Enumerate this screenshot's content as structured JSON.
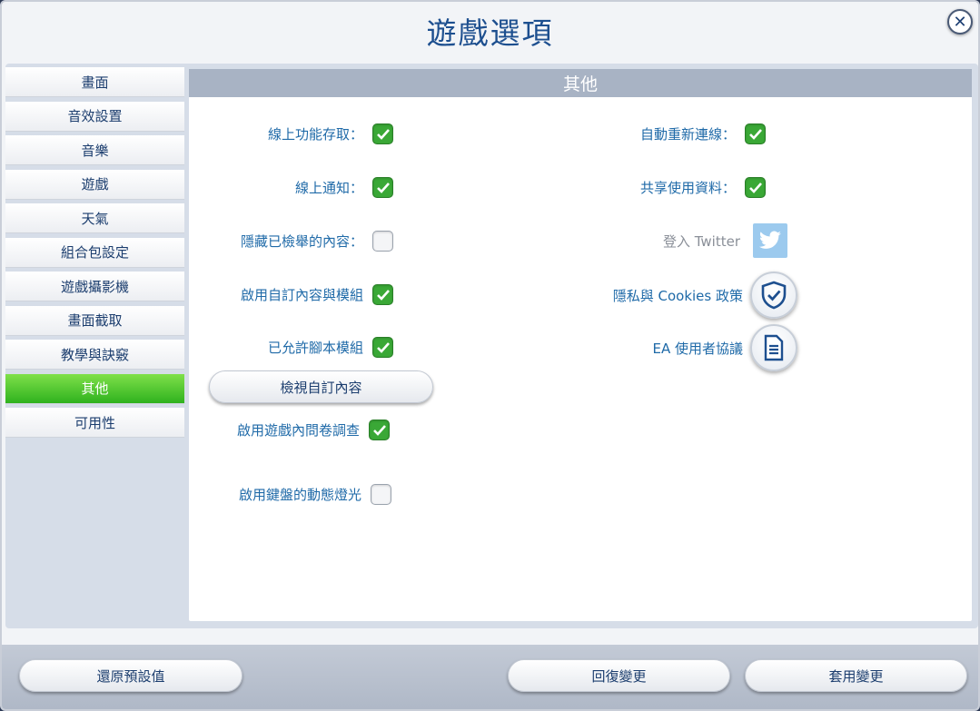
{
  "window": {
    "title": "遊戲選項",
    "close_icon": "close-icon"
  },
  "sidebar": {
    "items": [
      {
        "label": "畫面"
      },
      {
        "label": "音效設置"
      },
      {
        "label": "音樂"
      },
      {
        "label": "遊戲"
      },
      {
        "label": "天氣"
      },
      {
        "label": "組合包設定"
      },
      {
        "label": "遊戲攝影機"
      },
      {
        "label": "畫面截取"
      },
      {
        "label": "教學與訣竅"
      },
      {
        "label": "其他",
        "active": true
      },
      {
        "label": "可用性"
      }
    ],
    "active_color": "#4cc832"
  },
  "section": {
    "title": "其他",
    "left_options": [
      {
        "label": "線上功能存取：",
        "checked": true
      },
      {
        "label": "線上通知：",
        "checked": true
      },
      {
        "label": "隱藏已檢舉的內容：",
        "checked": false
      },
      {
        "label": "啟用自訂內容與模組",
        "checked": true
      },
      {
        "label": "已允許腳本模組",
        "checked": true
      },
      {
        "label": "啟用遊戲內問卷調查",
        "checked": true
      },
      {
        "label": "啟用鍵盤的動態燈光",
        "checked": false
      }
    ],
    "view_custom_content_button": "檢視自訂內容",
    "right_options": [
      {
        "label": "自動重新連線：",
        "checked": true
      },
      {
        "label": "共享使用資料：",
        "checked": true
      }
    ],
    "twitter": {
      "label": "登入 Twitter",
      "icon": "twitter-icon"
    },
    "privacy": {
      "label": "隱私與 Cookies 政策",
      "icon": "shield-check-icon"
    },
    "eula": {
      "label": "EA 使用者協議",
      "icon": "document-icon"
    }
  },
  "footer": {
    "restore_defaults": "還原預設值",
    "revert_changes": "回復變更",
    "apply_changes": "套用變更"
  },
  "colors": {
    "checkbox_on": "#3aa836",
    "title": "#1d4f8f",
    "label": "#1f6aa8"
  }
}
